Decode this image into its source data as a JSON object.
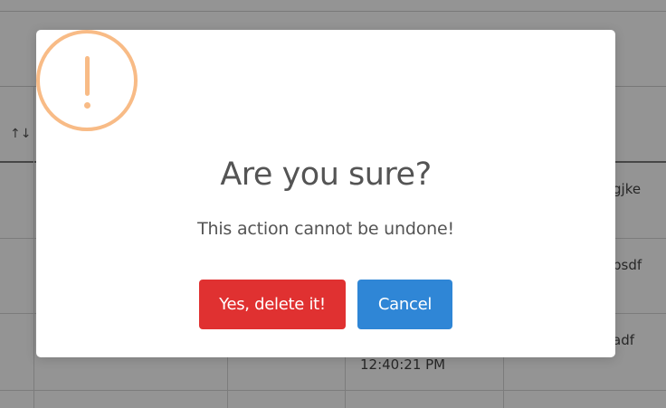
{
  "background_table": {
    "sort_icon": "↑↓",
    "cells": [
      "gjke",
      "bsdf",
      "adf",
      "12:40:21 PM"
    ]
  },
  "dialog": {
    "icon": "warning-icon",
    "title": "Are you sure?",
    "text": "This action cannot be undone!",
    "confirm_label": "Yes, delete it!",
    "cancel_label": "Cancel",
    "colors": {
      "icon": "#f8bb86",
      "confirm": "#e03131",
      "cancel": "#2f86d6",
      "text": "#545454"
    }
  }
}
